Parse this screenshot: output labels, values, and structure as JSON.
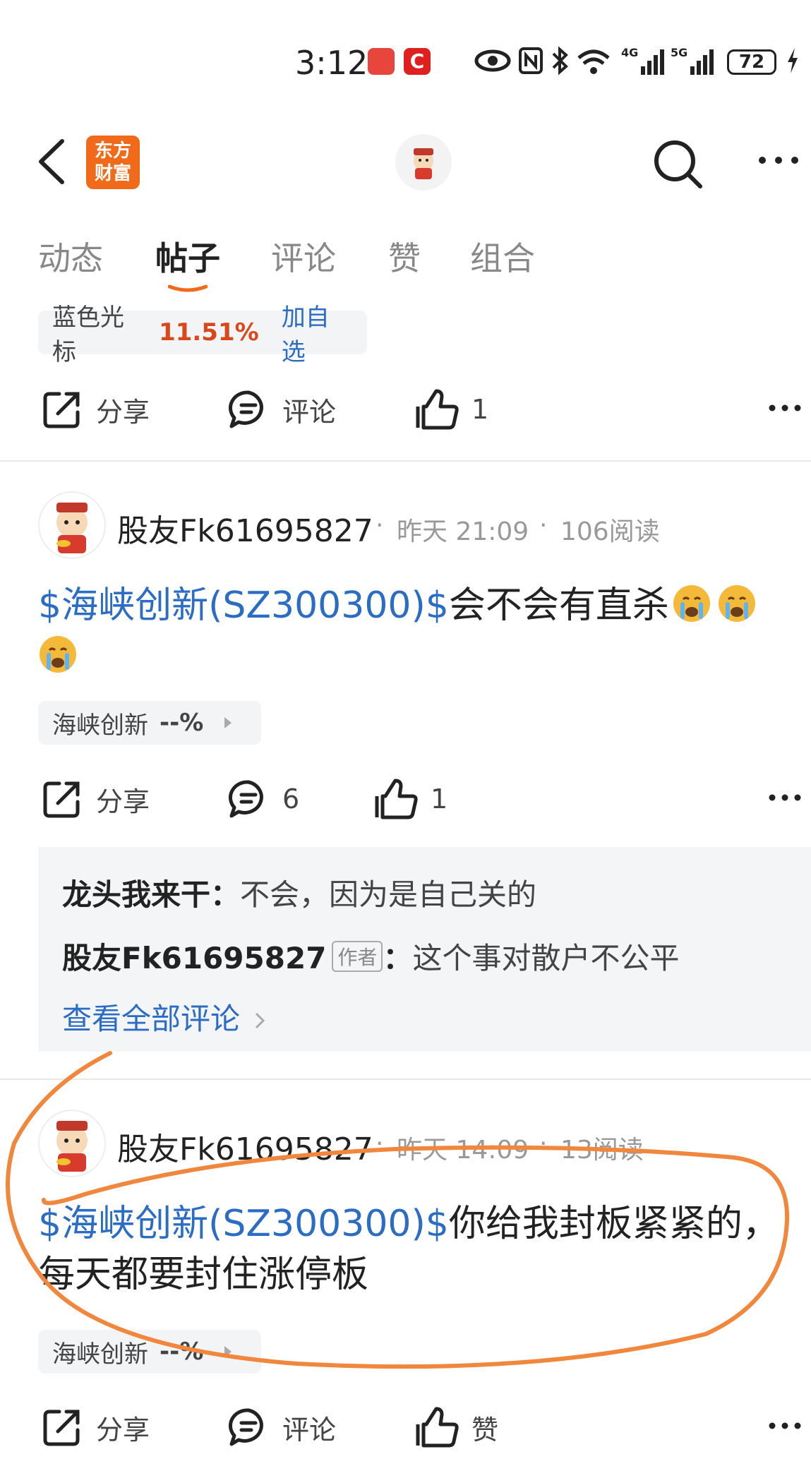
{
  "status_bar": {
    "time": "3:12",
    "battery": "72"
  },
  "header": {
    "brand_logo_text": "东方财富"
  },
  "tabs": [
    {
      "label": "动态",
      "active": false
    },
    {
      "label": "帖子",
      "active": true
    },
    {
      "label": "评论",
      "active": false
    },
    {
      "label": "赞",
      "active": false
    },
    {
      "label": "组合",
      "active": false
    }
  ],
  "top_stock_chip": {
    "name": "蓝色光标",
    "change": "11.51%",
    "add_label": "加自选"
  },
  "first_actions": {
    "share": "分享",
    "comment": "评论",
    "like_count": "1"
  },
  "posts": [
    {
      "username": "股友Fk61695827",
      "sep1": "·",
      "time": "昨天 21:09",
      "sep2": "·",
      "reads": "106阅读",
      "stock_tag": "$海峡创新(SZ300300)$",
      "text": "会不会有直杀",
      "chip_name": "海峡创新",
      "chip_change": "--%",
      "share": "分享",
      "comment_count": "6",
      "like_count": "1",
      "comments": [
        {
          "user": "龙头我来干",
          "colon": "：",
          "text": "不会，因为是自己关的"
        },
        {
          "user": "股友Fk61695827",
          "tag": "作者",
          "colon": "：",
          "text": "这个事对散户不公平"
        }
      ],
      "view_all": "查看全部评论"
    },
    {
      "username": "股友Fk61695827",
      "sep1": "·",
      "time": "昨天 14:09",
      "sep2": "·",
      "reads": "13阅读",
      "stock_tag": "$海峡创新(SZ300300)$",
      "text": "你给我封板紧紧的，每天都要封住涨停板",
      "chip_name": "海峡创新",
      "chip_change": "--%",
      "share": "分享",
      "comment": "评论",
      "like": "赞"
    }
  ],
  "colors": {
    "link": "#2b6cc4",
    "accent": "#f06a19",
    "up": "#d9481a",
    "annotation": "#f0873c"
  }
}
